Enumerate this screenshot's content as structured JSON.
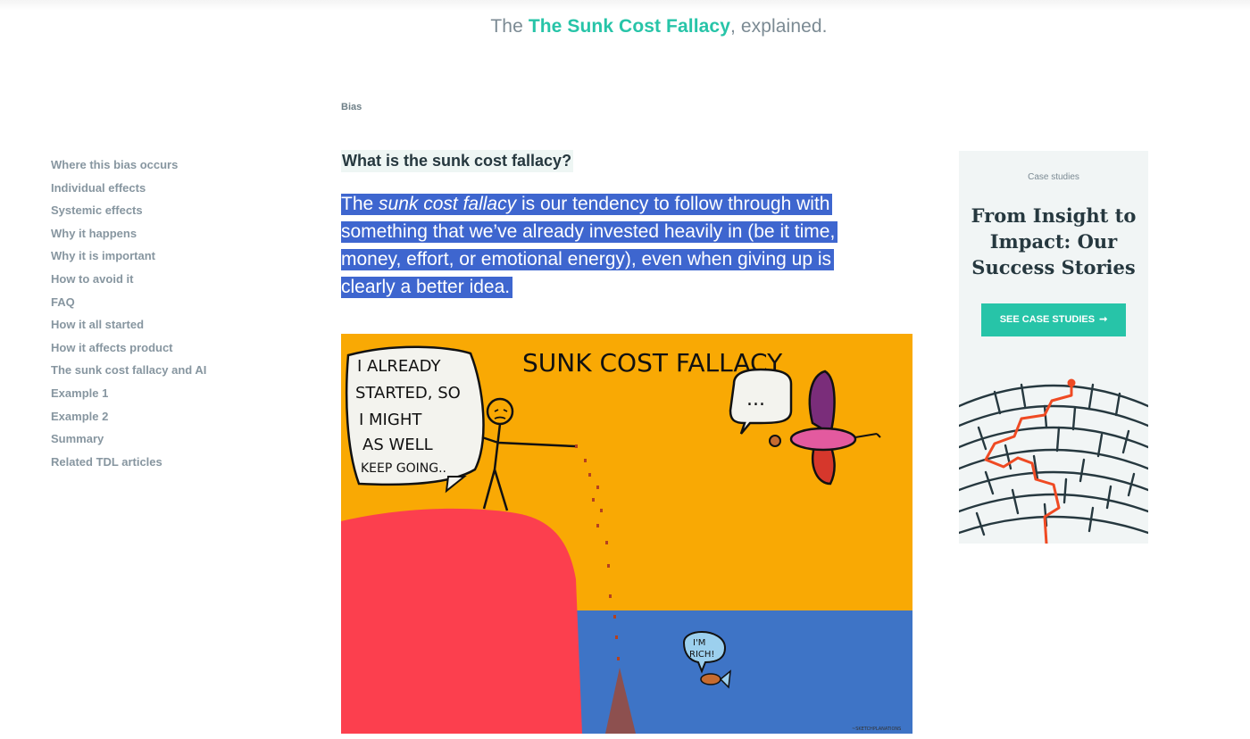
{
  "header": {
    "prefix": "The",
    "title": "The Sunk Cost Fallacy",
    "suffix": ", explained."
  },
  "breadcrumb": "Bias",
  "toc": [
    "Where this bias occurs",
    "Individual effects",
    "Systemic effects",
    "Why it happens",
    "Why it is important",
    "How to avoid it",
    "FAQ",
    "How it all started",
    "How it affects product",
    "The sunk cost fallacy and AI",
    "Example 1",
    "Example 2",
    "Summary",
    "Related TDL articles"
  ],
  "article": {
    "heading": "What is the sunk cost fallacy?",
    "intro_lead": "The ",
    "intro_term": "sunk cost fallacy",
    "intro_rest": " is our tendency to follow through with something that we’ve already invested heavily in (be it time, money, effort, or emotional energy), even when giving up is clearly a better idea."
  },
  "comic": {
    "title": "SUNK COST FALLACY",
    "speech_lines": [
      "I ALREADY",
      "STARTED, SO",
      "I MIGHT",
      "AS WELL",
      "KEEP GOING.."
    ],
    "bird_speech": "...",
    "fish_speech_lines": [
      "I'M",
      "RICH!"
    ],
    "credit": "~SKETCHPLANATIONS"
  },
  "sidebar": {
    "eyebrow": "Case studies",
    "title_lines": [
      "From Insight to",
      "Impact: Our",
      "Success Stories"
    ],
    "cta_label": "SEE CASE STUDIES",
    "cta_icon": "arrow-right-icon"
  },
  "colors": {
    "accent": "#27c4a8",
    "selection": "#3e66cf",
    "comic_sky": "#f9a904",
    "comic_cliff": "#fc3f4e",
    "comic_water": "#3e74c6",
    "maze_highlight": "#ef4a23"
  }
}
